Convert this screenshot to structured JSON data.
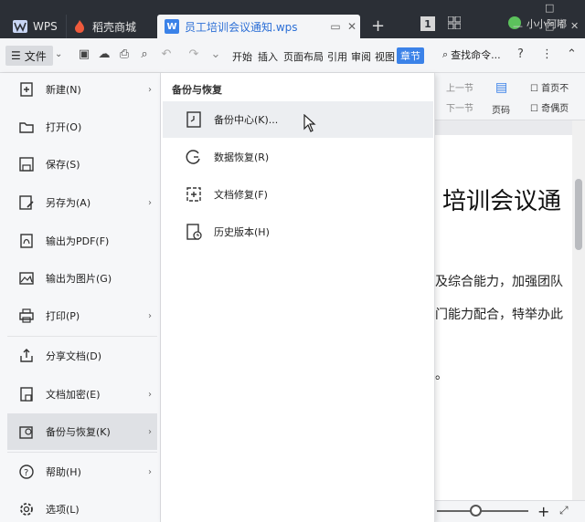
{
  "titlebar": {
    "app_tab": "WPS",
    "store_tab": "稻壳商城",
    "doc_tab": "员工培训会议通知.wps",
    "doc_badge": "W",
    "new_tab": "+",
    "box_label": "1",
    "user_name": "小小阿嘟",
    "window_controls": [
      "□",
      "—",
      "□",
      "✕"
    ]
  },
  "toolbar": {
    "file_label": "文件",
    "menu_tabs": [
      "开始",
      "插入",
      "页面布局",
      "引用",
      "审阅",
      "视图",
      "章节"
    ],
    "active_tab": "章节",
    "search_label": "查找命令...",
    "help": "?"
  },
  "ribbon2": {
    "prev_section": "上一节",
    "next_section": "下一节",
    "page_number": "页码",
    "first_page": "首页不",
    "odd_even": "奇偶页"
  },
  "left_menu": {
    "items": [
      {
        "label": "新建(N)",
        "icon": "new-doc-icon",
        "arrow": true
      },
      {
        "label": "打开(O)",
        "icon": "folder-icon",
        "arrow": false
      },
      {
        "label": "保存(S)",
        "icon": "save-icon",
        "arrow": false
      },
      {
        "label": "另存为(A)",
        "icon": "save-as-icon",
        "arrow": true
      },
      {
        "label": "输出为PDF(F)",
        "icon": "pdf-icon",
        "arrow": false
      },
      {
        "label": "输出为图片(G)",
        "icon": "image-icon",
        "arrow": false
      },
      {
        "label": "打印(P)",
        "icon": "printer-icon",
        "arrow": true
      },
      {
        "label": "分享文档(D)",
        "icon": "share-icon",
        "arrow": false
      },
      {
        "label": "文档加密(E)",
        "icon": "lock-icon",
        "arrow": true
      },
      {
        "label": "备份与恢复(K)",
        "icon": "backup-icon",
        "arrow": true
      },
      {
        "label": "帮助(H)",
        "icon": "help-icon",
        "arrow": true
      },
      {
        "label": "选项(L)",
        "icon": "gear-icon",
        "arrow": false
      }
    ],
    "active_index": 9
  },
  "submenu": {
    "header": "备份与恢复",
    "items": [
      {
        "label": "备份中心(K)...",
        "icon": "backup-center-icon"
      },
      {
        "label": "数据恢复(R)",
        "icon": "data-recovery-icon"
      },
      {
        "label": "文档修复(F)",
        "icon": "doc-repair-icon"
      },
      {
        "label": "历史版本(H)",
        "icon": "history-version-icon"
      }
    ],
    "hover_index": 0
  },
  "document": {
    "title_fragment": "培训会议通",
    "line1": "及综合能力，加强团队",
    "line2": "门能力配合，特举办此",
    "line3": "。"
  },
  "status": {
    "zoom_plus": "+"
  },
  "colors": {
    "titlebar": "#2b2f36",
    "accent": "#3b82e8",
    "menu_bg": "#f6f7f9",
    "active_item": "#dfe1e5"
  }
}
